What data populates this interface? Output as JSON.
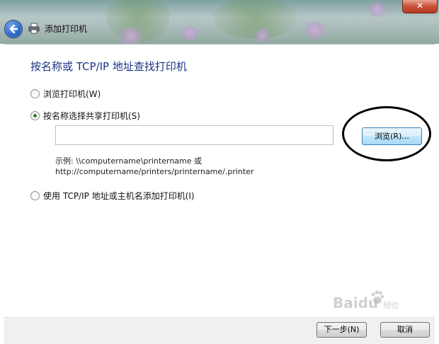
{
  "window": {
    "title": "添加打印机",
    "close_glyph": "✕",
    "back_icon": "back-arrow-icon",
    "printer_icon": "printer-icon"
  },
  "page": {
    "heading": "按名称或 TCP/IP 地址查找打印机"
  },
  "options": [
    {
      "label": "浏览打印机(W)",
      "checked": false
    },
    {
      "label": "按名称选择共享打印机(S)",
      "checked": true
    },
    {
      "label": "使用 TCP/IP 地址或主机名添加打印机(I)",
      "checked": false
    }
  ],
  "path_input": {
    "value": "",
    "placeholder": ""
  },
  "browse_button": {
    "label": "浏览(R)..."
  },
  "example": {
    "line1": "示例: \\\\computername\\printername 或",
    "line2": "http://computername/printers/printername/.printer"
  },
  "footer": {
    "next_label": "下一步(N)",
    "cancel_label": "取消"
  },
  "watermark": {
    "text": "Baidu",
    "subtext": "经验"
  },
  "colors": {
    "heading": "#1e3287",
    "annotation": "#000000"
  }
}
